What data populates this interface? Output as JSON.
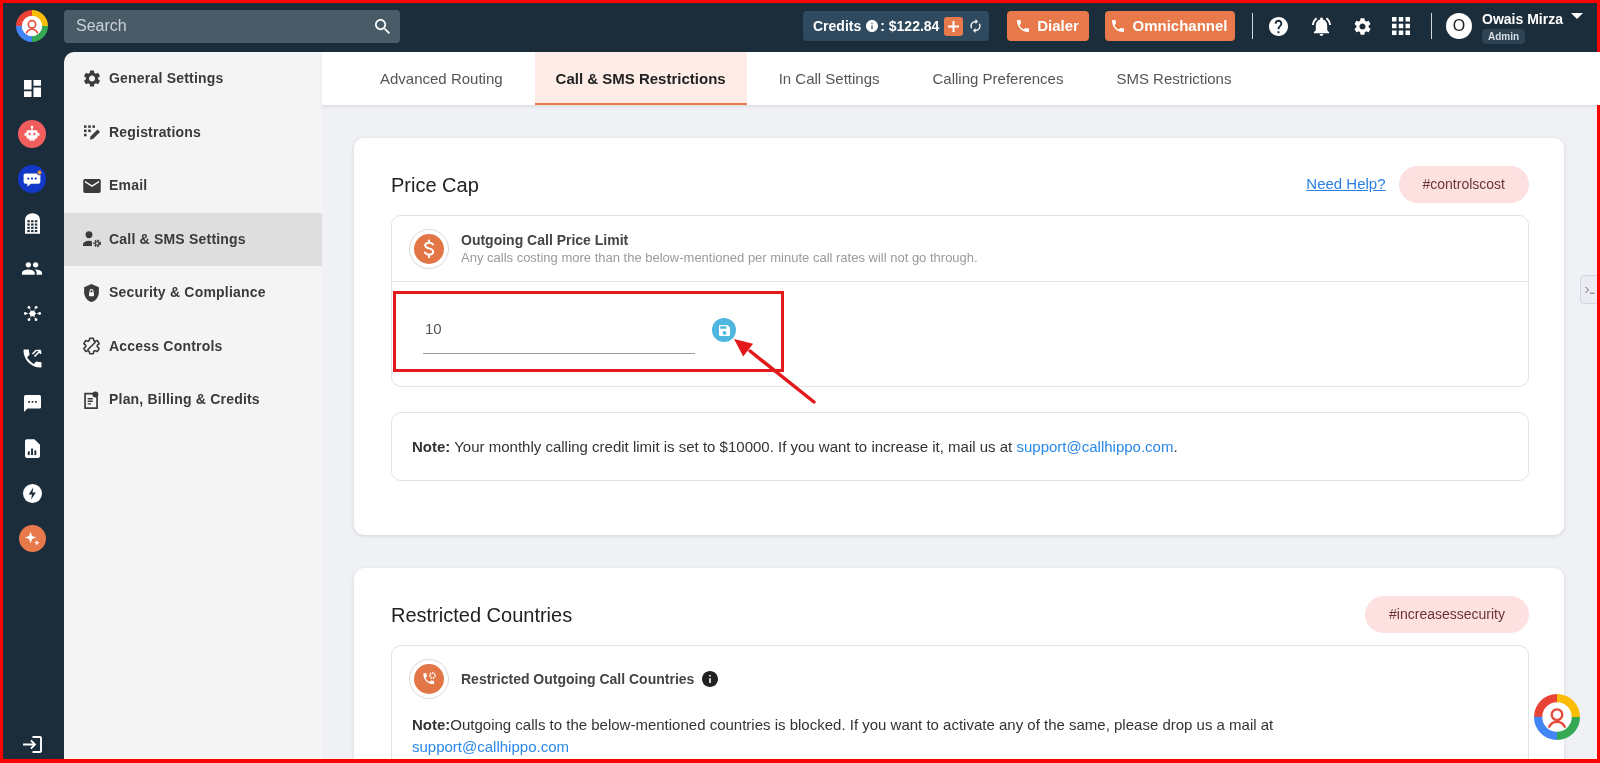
{
  "top_bar": {
    "search": {
      "placeholder": "Search"
    },
    "credits": {
      "label": "Credits",
      "amount": ": $122.84"
    },
    "buttons": [
      {
        "label": "Dialer"
      },
      {
        "label": "Omnichannel"
      }
    ],
    "user": {
      "initial": "O",
      "name": "Owais Mirza",
      "role": "Admin"
    }
  },
  "settings_menu": {
    "items": [
      {
        "label": "General Settings",
        "selected": false
      },
      {
        "label": "Registrations",
        "selected": false
      },
      {
        "label": "Email",
        "selected": false
      },
      {
        "label": "Call & SMS Settings",
        "selected": true
      },
      {
        "label": "Security & Compliance",
        "selected": false
      },
      {
        "label": "Access Controls",
        "selected": false
      },
      {
        "label": "Plan, Billing & Credits",
        "selected": false
      }
    ]
  },
  "tabs": [
    {
      "label": "Advanced Routing",
      "selected": false
    },
    {
      "label": "Call & SMS Restrictions",
      "selected": true
    },
    {
      "label": "In Call Settings",
      "selected": false
    },
    {
      "label": "Calling Preferences",
      "selected": false
    },
    {
      "label": "SMS Restrictions",
      "selected": false
    }
  ],
  "price_cap": {
    "title": "Price Cap",
    "help_link": "Need Help?",
    "tag": "#controlscost",
    "setting": {
      "title": "Outgoing Call Price Limit",
      "description": "Any calls costing more than the below-mentioned per minute call rates will not go through."
    },
    "input": {
      "value": "10"
    },
    "note": {
      "text": "**Note:** Your monthly calling credit limit is set to $10000. If you want to increase it, mail us at",
      "link": "support@callhippo.com",
      "end": "."
    }
  },
  "restricted_countries": {
    "title": "Restricted Countries",
    "tag": "#increasessecurity",
    "setting": {
      "title": "Restricted Outgoing Call Countries"
    },
    "note": {
      "text": "**Note:**Outgoing calls to the below-mentioned countries is blocked. If you want to activate any of the same, please drop us a mail at",
      "link": "support@callhippo.com"
    }
  }
}
